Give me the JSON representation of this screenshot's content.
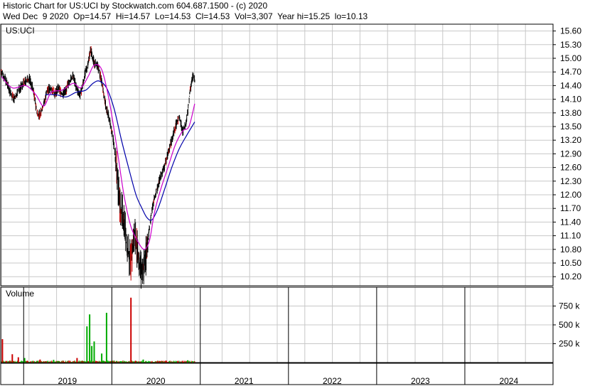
{
  "header": {
    "line1": "Historic Chart for US:UCI by Stockwatch.com 604.687.1500 - (c) 2020",
    "line2": "Wed Dec  9 2020  Op=14.57  Hi=14.57  Lo=14.53  Cl=14.53  Vol=3,307  Year hi=15.25  lo=10.13"
  },
  "colors": {
    "grid": "#c8c8c8",
    "frame": "#000000",
    "ma_short": "#cc00cc",
    "ma_long": "#0000aa",
    "up_volume": "#00aa00",
    "down_volume": "#cc0000",
    "price_bar": "#000000",
    "price_bar_down": "#cc0000"
  },
  "chart_data": [
    {
      "type": "ohlc",
      "label": "US:UCI",
      "ylim": [
        10.0,
        15.75
      ],
      "yticks": [
        15.6,
        15.3,
        15.0,
        14.7,
        14.4,
        14.1,
        13.8,
        13.5,
        13.2,
        12.9,
        12.6,
        12.3,
        12.0,
        11.7,
        11.4,
        11.1,
        10.8,
        10.5,
        10.2
      ],
      "ytick_labels": [
        "15.60",
        "15.30",
        "15.00",
        "14.70",
        "14.40",
        "14.10",
        "13.80",
        "13.50",
        "13.20",
        "12.90",
        "12.60",
        "12.30",
        "12.00",
        "11.70",
        "11.40",
        "11.10",
        "10.80",
        "10.50",
        "10.20"
      ],
      "x_axis_labels": [
        "2019",
        "2020",
        "2021",
        "2022",
        "2023",
        "2024"
      ],
      "x_range": [
        "2018-10-01",
        "2024-12-31"
      ],
      "last_close": 14.53,
      "price_path": [
        [
          "2018-10-01",
          14.7
        ],
        [
          "2018-10-20",
          14.5
        ],
        [
          "2018-11-10",
          14.2
        ],
        [
          "2018-11-25",
          14.1
        ],
        [
          "2018-12-10",
          14.3
        ],
        [
          "2018-12-25",
          14.4
        ],
        [
          "2019-01-10",
          14.5
        ],
        [
          "2019-01-25",
          14.55
        ],
        [
          "2019-02-10",
          14.3
        ],
        [
          "2019-02-25",
          13.8
        ],
        [
          "2019-03-10",
          13.75
        ],
        [
          "2019-03-25",
          14.0
        ],
        [
          "2019-04-10",
          14.3
        ],
        [
          "2019-04-25",
          14.35
        ],
        [
          "2019-05-10",
          14.2
        ],
        [
          "2019-05-25",
          14.35
        ],
        [
          "2019-06-10",
          14.2
        ],
        [
          "2019-06-25",
          14.3
        ],
        [
          "2019-07-10",
          14.5
        ],
        [
          "2019-07-25",
          14.6
        ],
        [
          "2019-08-10",
          14.3
        ],
        [
          "2019-08-25",
          14.2
        ],
        [
          "2019-09-10",
          14.6
        ],
        [
          "2019-09-25",
          14.9
        ],
        [
          "2019-10-05",
          15.2
        ],
        [
          "2019-10-20",
          14.9
        ],
        [
          "2019-11-05",
          14.8
        ],
        [
          "2019-11-20",
          14.5
        ],
        [
          "2019-12-05",
          14.0
        ],
        [
          "2019-12-20",
          13.7
        ],
        [
          "2020-01-05",
          13.3
        ],
        [
          "2020-01-20",
          12.6
        ],
        [
          "2020-02-05",
          11.7
        ],
        [
          "2020-02-20",
          11.5
        ],
        [
          "2020-03-05",
          10.8
        ],
        [
          "2020-03-20",
          10.5
        ],
        [
          "2020-04-05",
          11.2
        ],
        [
          "2020-04-20",
          10.6
        ],
        [
          "2020-05-05",
          10.3
        ],
        [
          "2020-05-20",
          10.6
        ],
        [
          "2020-06-05",
          11.3
        ],
        [
          "2020-06-20",
          11.8
        ],
        [
          "2020-07-05",
          12.1
        ],
        [
          "2020-07-20",
          12.4
        ],
        [
          "2020-08-05",
          12.6
        ],
        [
          "2020-08-20",
          12.9
        ],
        [
          "2020-09-05",
          13.2
        ],
        [
          "2020-09-20",
          13.5
        ],
        [
          "2020-10-05",
          13.7
        ],
        [
          "2020-10-20",
          13.4
        ],
        [
          "2020-11-05",
          13.6
        ],
        [
          "2020-11-20",
          14.3
        ],
        [
          "2020-12-01",
          14.6
        ],
        [
          "2020-12-09",
          14.53
        ]
      ],
      "ma_short": [
        [
          "2018-10-01",
          14.6
        ],
        [
          "2018-11-15",
          14.35
        ],
        [
          "2019-01-10",
          14.4
        ],
        [
          "2019-02-20",
          14.2
        ],
        [
          "2019-03-25",
          13.95
        ],
        [
          "2019-04-25",
          14.25
        ],
        [
          "2019-06-10",
          14.3
        ],
        [
          "2019-07-25",
          14.45
        ],
        [
          "2019-08-25",
          14.35
        ],
        [
          "2019-09-25",
          14.6
        ],
        [
          "2019-10-20",
          14.85
        ],
        [
          "2019-11-20",
          14.75
        ],
        [
          "2019-12-20",
          14.1
        ],
        [
          "2020-01-20",
          13.1
        ],
        [
          "2020-02-20",
          12.0
        ],
        [
          "2020-03-20",
          11.3
        ],
        [
          "2020-04-20",
          10.95
        ],
        [
          "2020-05-15",
          10.8
        ],
        [
          "2020-06-05",
          11.0
        ],
        [
          "2020-06-25",
          11.6
        ],
        [
          "2020-07-20",
          12.1
        ],
        [
          "2020-08-20",
          12.6
        ],
        [
          "2020-09-20",
          13.1
        ],
        [
          "2020-10-20",
          13.4
        ],
        [
          "2020-11-15",
          13.5
        ],
        [
          "2020-12-09",
          14.0
        ]
      ],
      "ma_long": [
        [
          "2019-04-01",
          14.2
        ],
        [
          "2019-05-15",
          14.2
        ],
        [
          "2019-06-25",
          14.15
        ],
        [
          "2019-08-05",
          14.25
        ],
        [
          "2019-09-15",
          14.3
        ],
        [
          "2019-10-15",
          14.45
        ],
        [
          "2019-11-10",
          14.5
        ],
        [
          "2019-12-10",
          14.35
        ],
        [
          "2020-01-10",
          13.9
        ],
        [
          "2020-02-10",
          13.2
        ],
        [
          "2020-03-10",
          12.6
        ],
        [
          "2020-04-10",
          12.0
        ],
        [
          "2020-05-05",
          11.7
        ],
        [
          "2020-05-25",
          11.5
        ],
        [
          "2020-06-15",
          11.45
        ],
        [
          "2020-07-10",
          11.7
        ],
        [
          "2020-08-05",
          12.1
        ],
        [
          "2020-09-05",
          12.6
        ],
        [
          "2020-10-05",
          13.0
        ],
        [
          "2020-11-05",
          13.3
        ],
        [
          "2020-12-09",
          13.6
        ]
      ]
    },
    {
      "type": "bar",
      "label": "Volume",
      "ylim": [
        0,
        1000
      ],
      "yticks": [
        750,
        500,
        250
      ],
      "ytick_labels": [
        "750 k",
        "500 k",
        "250 k"
      ],
      "spikes": [
        {
          "date": "2018-10-05",
          "value": 310,
          "dir": "down"
        },
        {
          "date": "2018-11-15",
          "value": 110,
          "dir": "down"
        },
        {
          "date": "2018-12-10",
          "value": 70,
          "dir": "down"
        },
        {
          "date": "2019-01-05",
          "value": 60,
          "dir": "up"
        },
        {
          "date": "2019-03-10",
          "value": 40,
          "dir": "down"
        },
        {
          "date": "2019-05-05",
          "value": 35,
          "dir": "up"
        },
        {
          "date": "2019-08-10",
          "value": 60,
          "dir": "down"
        },
        {
          "date": "2019-09-20",
          "value": 480,
          "dir": "up"
        },
        {
          "date": "2019-10-01",
          "value": 640,
          "dir": "up"
        },
        {
          "date": "2019-10-10",
          "value": 220,
          "dir": "up"
        },
        {
          "date": "2019-10-20",
          "value": 280,
          "dir": "up"
        },
        {
          "date": "2019-11-20",
          "value": 120,
          "dir": "up"
        },
        {
          "date": "2019-12-10",
          "value": 660,
          "dir": "up"
        },
        {
          "date": "2020-03-20",
          "value": 860,
          "dir": "down"
        },
        {
          "date": "2020-05-10",
          "value": 40,
          "dir": "up"
        },
        {
          "date": "2020-08-10",
          "value": 25,
          "dir": "down"
        },
        {
          "date": "2020-11-10",
          "value": 30,
          "dir": "up"
        }
      ],
      "baseline_level": 20
    }
  ]
}
